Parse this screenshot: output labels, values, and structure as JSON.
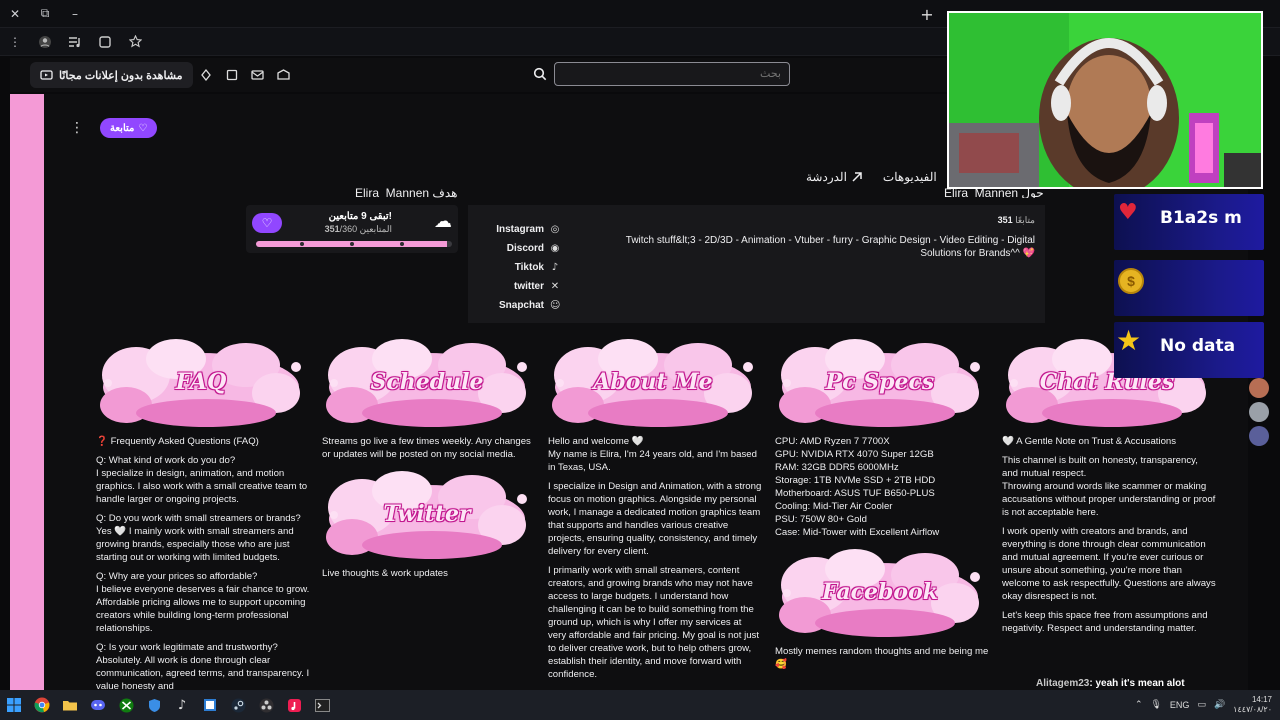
{
  "browser": {
    "close_icon": "✕",
    "tab_icon": "⧉",
    "minimize_icon": "–",
    "new_tab_icon": "+",
    "menu_icon": "⋮"
  },
  "twitch_nav": {
    "promo_label": "مشاهدة بدون إعلانات مجانًا",
    "search_placeholder": "بحث"
  },
  "channel": {
    "follow_label": "متابعة",
    "tabs": [
      {
        "label": "الدردشة"
      },
      {
        "label": "الفيديوهات"
      }
    ],
    "goal_cut_title": "Elira_Mannen هدف",
    "about_cut_title": "Elira_Mannen حول"
  },
  "goal": {
    "title": "تبقى 9 متابعين!",
    "subtitle_count": "351",
    "subtitle_rest": "/360 المتابعين",
    "progress": 0.975
  },
  "about": {
    "followers_count": "351",
    "followers_label": "متابعًا",
    "bio": "Twitch stuff&lt;3 - 2D/3D - Animation - Vtuber - furry - Graphic Design - Video Editing - Digital Solutions for Brands^^ 💖",
    "socials": [
      {
        "label": "Instagram",
        "icon": "instagram-icon"
      },
      {
        "label": "Discord",
        "icon": "discord-icon"
      },
      {
        "label": "Tiktok",
        "icon": "tiktok-icon"
      },
      {
        "label": "twitter",
        "icon": "x-icon"
      },
      {
        "label": "Snapchat",
        "icon": "snapchat-icon"
      }
    ]
  },
  "panels": {
    "faq": {
      "title": "FAQ",
      "lines": [
        "❓ Frequently Asked Questions (FAQ)",
        "Q: What kind of work do you do?\nI specialize in design, animation, and motion graphics. I also work with a small creative team to handle larger or ongoing projects.",
        "Q: Do you work with small streamers or brands?\nYes 🤍 I mainly work with small streamers and growing brands, especially those who are just starting out or working with limited budgets.",
        "Q: Why are your prices so affordable?\nI believe everyone deserves a fair chance to grow. Affordable pricing allows me to support upcoming creators while building long-term professional relationships.",
        "Q: Is your work legitimate and trustworthy?\nAbsolutely. All work is done through clear communication, agreed terms, and transparency. I value honesty and"
      ]
    },
    "schedule": {
      "title": "Schedule",
      "text": "Streams go live a few times weekly. Any changes or updates will be posted on my social media.",
      "sub_title": "Twitter",
      "sub_text": "Live thoughts & work updates"
    },
    "about_me": {
      "title": "About Me",
      "lines": [
        "Hello and welcome 🤍\nMy name is Elira, I'm 24 years old, and I'm based in Texas, USA.",
        "I specialize in Design and Animation, with a strong focus on motion graphics. Alongside my personal work, I manage a dedicated motion graphics team that supports and handles various creative projects, ensuring quality, consistency, and timely delivery for every client.",
        "I primarily work with small streamers, content creators, and growing brands who may not have access to large budgets. I understand how challenging it can be to build something from the ground up, which is why I offer my services at very affordable and fair pricing. My goal is not just to deliver creative work, but to help others grow, establish their identity, and move forward with confidence."
      ]
    },
    "pc_specs": {
      "title": "Pc Specs",
      "text": "CPU: AMD Ryzen 7 7700X\nGPU: NVIDIA RTX 4070 Super 12GB\nRAM: 32GB DDR5 6000MHz\nStorage: 1TB NVMe SSD + 2TB HDD\nMotherboard: ASUS TUF B650-PLUS\nCooling: Mid-Tier Air Cooler\nPSU: 750W 80+ Gold\nCase: Mid-Tower with Excellent Airflow",
      "sub_title": "Facebook",
      "sub_text": "Mostly memes random thoughts and me being me 🥰"
    },
    "chat_rules": {
      "title": "Chat Rules",
      "lines": [
        "🤍 A Gentle Note on Trust & Accusations",
        "This channel is built on honesty, transparency, and mutual respect.\nThrowing around words like scammer or making accusations without proper understanding or proof is not acceptable here.",
        "I work openly with creators and brands, and everything is done through clear communication and mutual agreement. If you're ever curious or unsure about something, you're more than welcome to ask respectfully. Questions are always okay disrespect is not.",
        "Let's keep this space free from assumptions and negativity. Respect and understanding matter."
      ]
    }
  },
  "overlays": [
    {
      "icon": "heart-icon",
      "text": "B1a2s    m"
    },
    {
      "icon": "coin-icon",
      "text": ""
    },
    {
      "icon": "star-icon",
      "text": "No data"
    }
  ],
  "chat": {
    "user": "Alitagem23",
    "message": ": yeah it's mean alot"
  },
  "taskbar": {
    "lang": "ENG",
    "time": "14:17",
    "date": "١٤٤٧/٠٨/٢٠"
  },
  "colors": {
    "accent": "#9147ff",
    "pink": "#f49ad6"
  }
}
